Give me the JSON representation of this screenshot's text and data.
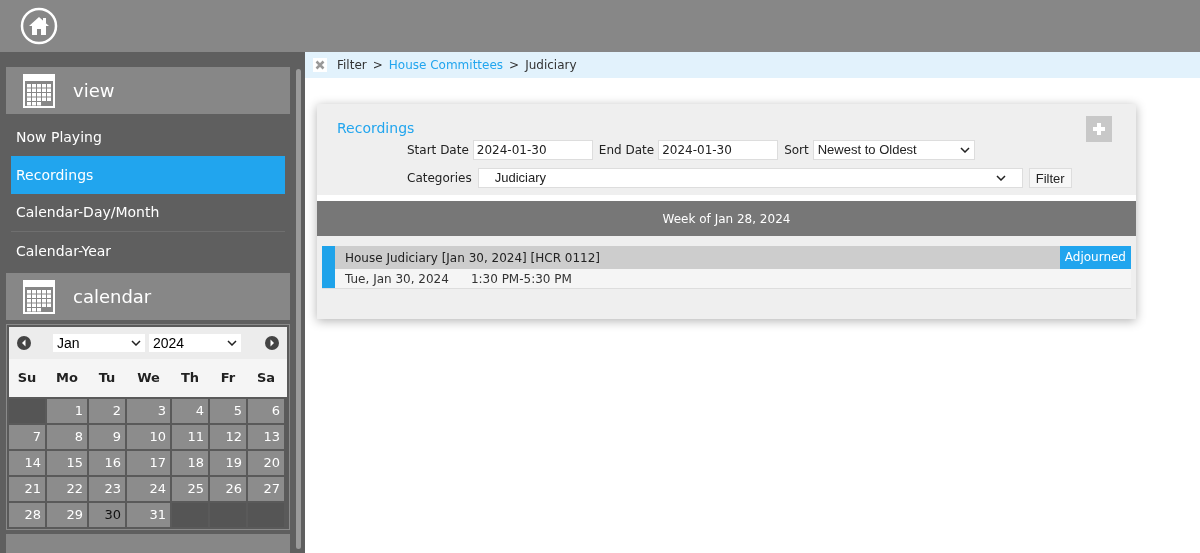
{
  "sidebar": {
    "view_panel": {
      "title": "view",
      "items": [
        {
          "label": "Now Playing",
          "selected": false
        },
        {
          "label": "Recordings",
          "selected": true
        },
        {
          "label": "Calendar-Day/Month",
          "selected": false
        },
        {
          "label": "Calendar-Year",
          "selected": false
        }
      ]
    },
    "calendar_panel": {
      "title": "calendar",
      "month": "Jan",
      "year": "2024",
      "weekdays": [
        "Su",
        "Mo",
        "Tu",
        "We",
        "Th",
        "Fr",
        "Sa"
      ],
      "weeks": [
        [
          {
            "day": "1",
            "selected": false
          },
          {
            "day": "2",
            "selected": false
          },
          {
            "day": "3",
            "selected": false
          },
          {
            "day": "4",
            "selected": false
          },
          {
            "day": "5",
            "selected": false
          },
          {
            "day": "6",
            "selected": false
          }
        ],
        [
          {
            "day": "7",
            "selected": false
          },
          {
            "day": "8",
            "selected": false
          },
          {
            "day": "9",
            "selected": false
          },
          {
            "day": "10",
            "selected": false
          },
          {
            "day": "11",
            "selected": false
          },
          {
            "day": "12",
            "selected": false
          },
          {
            "day": "13",
            "selected": false
          }
        ],
        [
          {
            "day": "14",
            "selected": false
          },
          {
            "day": "15",
            "selected": false
          },
          {
            "day": "16",
            "selected": false
          },
          {
            "day": "17",
            "selected": false
          },
          {
            "day": "18",
            "selected": false
          },
          {
            "day": "19",
            "selected": false
          },
          {
            "day": "20",
            "selected": false
          }
        ],
        [
          {
            "day": "21",
            "selected": false
          },
          {
            "day": "22",
            "selected": false
          },
          {
            "day": "23",
            "selected": false
          },
          {
            "day": "24",
            "selected": false
          },
          {
            "day": "25",
            "selected": false
          },
          {
            "day": "26",
            "selected": false
          },
          {
            "day": "27",
            "selected": false
          }
        ],
        [
          {
            "day": "28",
            "selected": false
          },
          {
            "day": "29",
            "selected": false
          },
          {
            "day": "30",
            "selected": true
          },
          {
            "day": "31",
            "selected": false
          }
        ]
      ]
    }
  },
  "breadcrumb": [
    {
      "label": "Filter",
      "kind": "text"
    },
    {
      "label": ">",
      "kind": "separator"
    },
    {
      "label": "House Committees",
      "kind": "link"
    },
    {
      "label": ">",
      "kind": "separator"
    },
    {
      "label": "Judiciary",
      "kind": "text"
    }
  ],
  "recordings": {
    "title": "Recordings",
    "start_date": {
      "label": "Start Date",
      "value": "2024-01-30"
    },
    "end_date": {
      "label": "End Date",
      "value": "2024-01-30"
    },
    "sort": {
      "label": "Sort",
      "value": "Newest to Oldest"
    },
    "categories": {
      "label": "Categories",
      "value": "Judiciary"
    },
    "filter_button": "Filter",
    "week_header": "Week of Jan 28, 2024",
    "events": [
      {
        "title": "House Judiciary [Jan 30, 2024] [HCR 0112]",
        "date": "Tue, Jan 30, 2024",
        "time": "1:30 PM-5:30 PM",
        "status": "Adjourned",
        "color": "#1fa3ea"
      }
    ]
  }
}
